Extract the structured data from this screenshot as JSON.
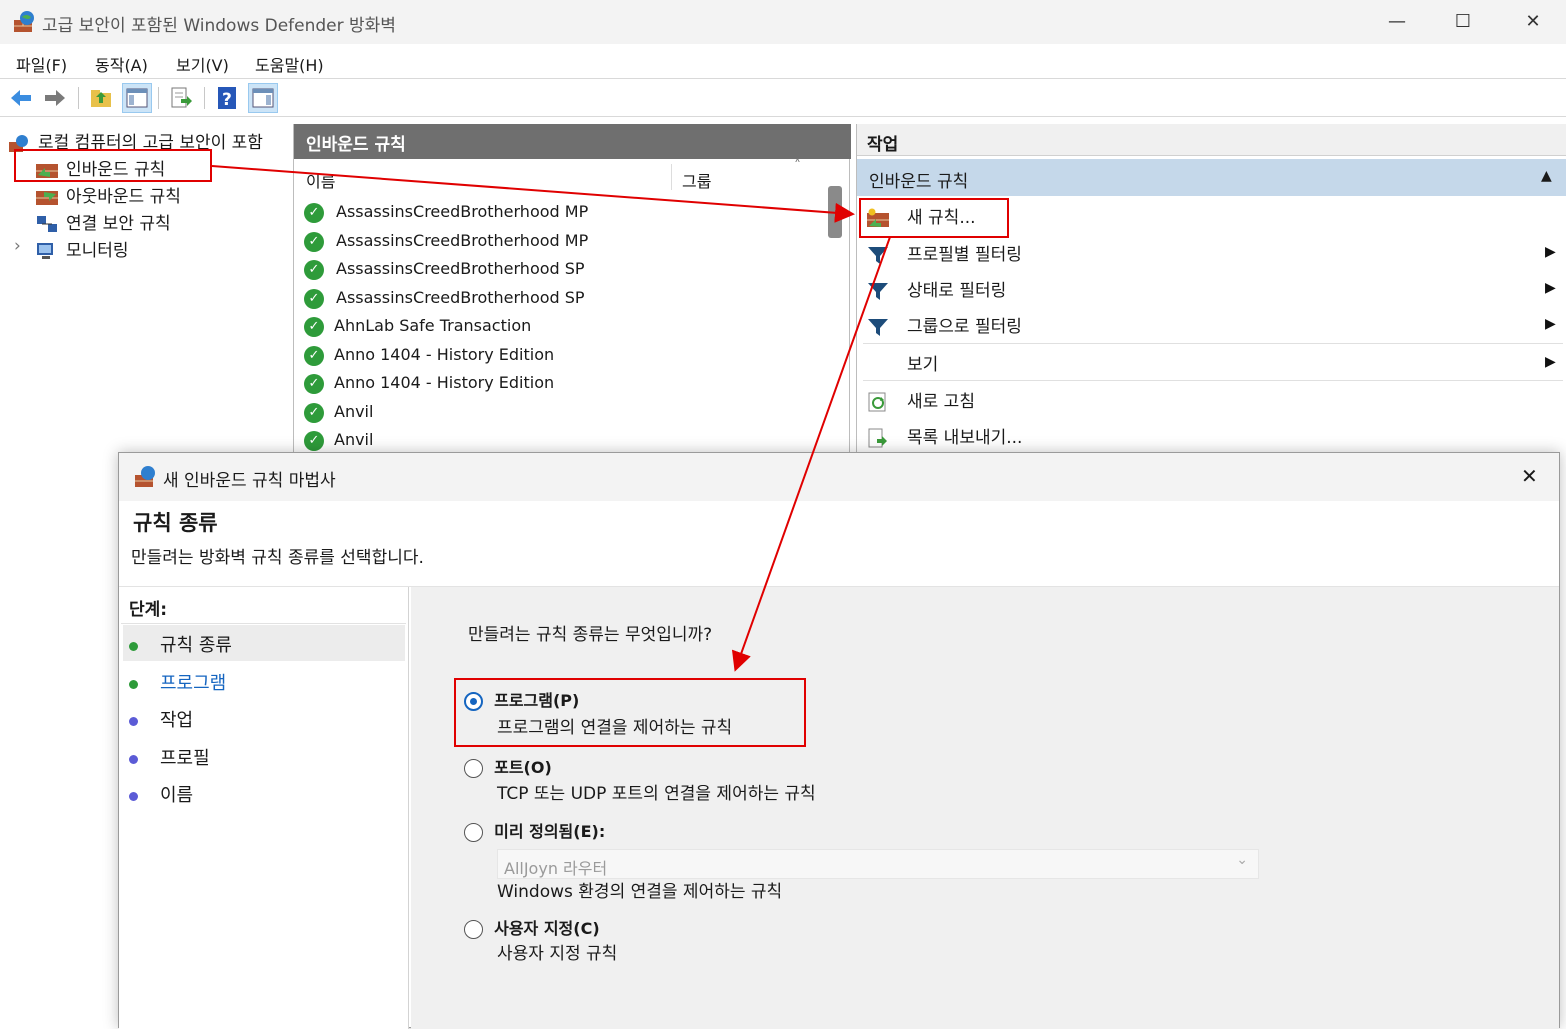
{
  "window": {
    "title": "고급 보안이 포함된 Windows Defender 방화벽",
    "minimize": "—",
    "maximize": "☐",
    "close": "✕"
  },
  "menu": [
    "파일(F)",
    "동작(A)",
    "보기(V)",
    "도움말(H)"
  ],
  "tree": {
    "root": "로컬 컴퓨터의 고급 보안이 포함",
    "items": [
      "인바운드 규칙",
      "아웃바운드 규칙",
      "연결 보안 규칙",
      "모니터링"
    ],
    "expand_glyph": "›"
  },
  "center": {
    "header": "인바운드 규칙",
    "columns": {
      "name": "이름",
      "group": "그룹"
    },
    "sort_glyph": "˄",
    "rows": [
      "AssassinsCreedBrotherhood MP",
      "AssassinsCreedBrotherhood MP",
      "AssassinsCreedBrotherhood SP",
      "AssassinsCreedBrotherhood SP",
      "AhnLab Safe Transaction",
      "Anno 1404 - History Edition",
      "Anno 1404 - History Edition",
      "Anvil",
      "Anvil"
    ],
    "check_glyph": "✓"
  },
  "actions": {
    "header": "작업",
    "section": "인바운드 규칙",
    "collapse_glyph": "▲",
    "items": [
      {
        "label": "새 규칙...",
        "submenu": false
      },
      {
        "label": "프로필별 필터링",
        "submenu": true
      },
      {
        "label": "상태로 필터링",
        "submenu": true
      },
      {
        "label": "그룹으로 필터링",
        "submenu": true
      },
      {
        "label": "보기",
        "submenu": true
      },
      {
        "label": "새로 고침",
        "submenu": false
      },
      {
        "label": "목록 내보내기...",
        "submenu": false
      }
    ],
    "submenu_glyph": "▶"
  },
  "dialog": {
    "title": "새 인바운드 규칙 마법사",
    "close": "✕",
    "heading": "규칙 종류",
    "subheading": "만들려는 방화벽 규칙 종류를 선택합니다.",
    "steps_label": "단계:",
    "steps": [
      {
        "label": "규칙 종류",
        "state": "current"
      },
      {
        "label": "프로그램",
        "state": "link"
      },
      {
        "label": "작업",
        "state": "pending"
      },
      {
        "label": "프로필",
        "state": "pending"
      },
      {
        "label": "이름",
        "state": "pending"
      }
    ],
    "question": "만들려는 규칙 종류는 무엇입니까?",
    "options": [
      {
        "label": "프로그램(P)",
        "desc": "프로그램의 연결을 제어하는 규칙",
        "selected": true
      },
      {
        "label": "포트(O)",
        "desc": "TCP 또는 UDP 포트의 연결을 제어하는 규칙",
        "selected": false
      },
      {
        "label": "미리 정의됨(E):",
        "desc": "Windows 환경의 연결을 제어하는 규칙",
        "selected": false
      },
      {
        "label": "사용자 지정(C)",
        "desc": "사용자 지정 규칙",
        "selected": false
      }
    ],
    "predefined_value": "AllJoyn 라우터",
    "combo_glyph": "⌄"
  },
  "colors": {
    "annotation_red": "#e00000",
    "step_done_green": "#2e9b3a",
    "step_pending_purple": "#5b5bd6",
    "link_blue": "#1565c0"
  }
}
